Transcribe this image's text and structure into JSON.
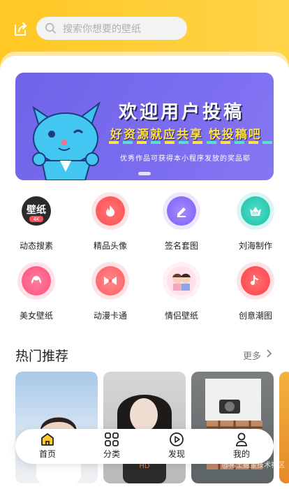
{
  "header": {
    "search_placeholder": "搜索你想要的壁纸"
  },
  "banner": {
    "title": "欢迎用户投稿",
    "subtitle": "好资源就应共享 快投稿吧",
    "note": "优秀作品可获得本小程序发放的奖品耶"
  },
  "categories": [
    {
      "label": "动态搜素",
      "icon": "wallpaper-4k-icon"
    },
    {
      "label": "精品头像",
      "icon": "flame-icon"
    },
    {
      "label": "签名套图",
      "icon": "pen-icon"
    },
    {
      "label": "刘海制作",
      "icon": "diy-crown-icon"
    },
    {
      "label": "美女壁纸",
      "icon": "hair-icon"
    },
    {
      "label": "动漫卡通",
      "icon": "bow-icon"
    },
    {
      "label": "情侣壁纸",
      "icon": "couple-icon"
    },
    {
      "label": "创意潮图",
      "icon": "music-note-icon"
    }
  ],
  "hot": {
    "title": "热门推荐",
    "more": "更多"
  },
  "tabbar": [
    {
      "label": "首页",
      "icon": "home-icon",
      "active": true
    },
    {
      "label": "分类",
      "icon": "grid-icon"
    },
    {
      "label": "发现",
      "icon": "play-circle-icon"
    },
    {
      "label": "我的",
      "icon": "user-icon"
    }
  ],
  "watermark": "@稀土掘金技术社区",
  "colors": {
    "header_yellow": "#ffc824",
    "banner_purple": "#7b6df0",
    "accent_red": "#ff5a5f"
  }
}
